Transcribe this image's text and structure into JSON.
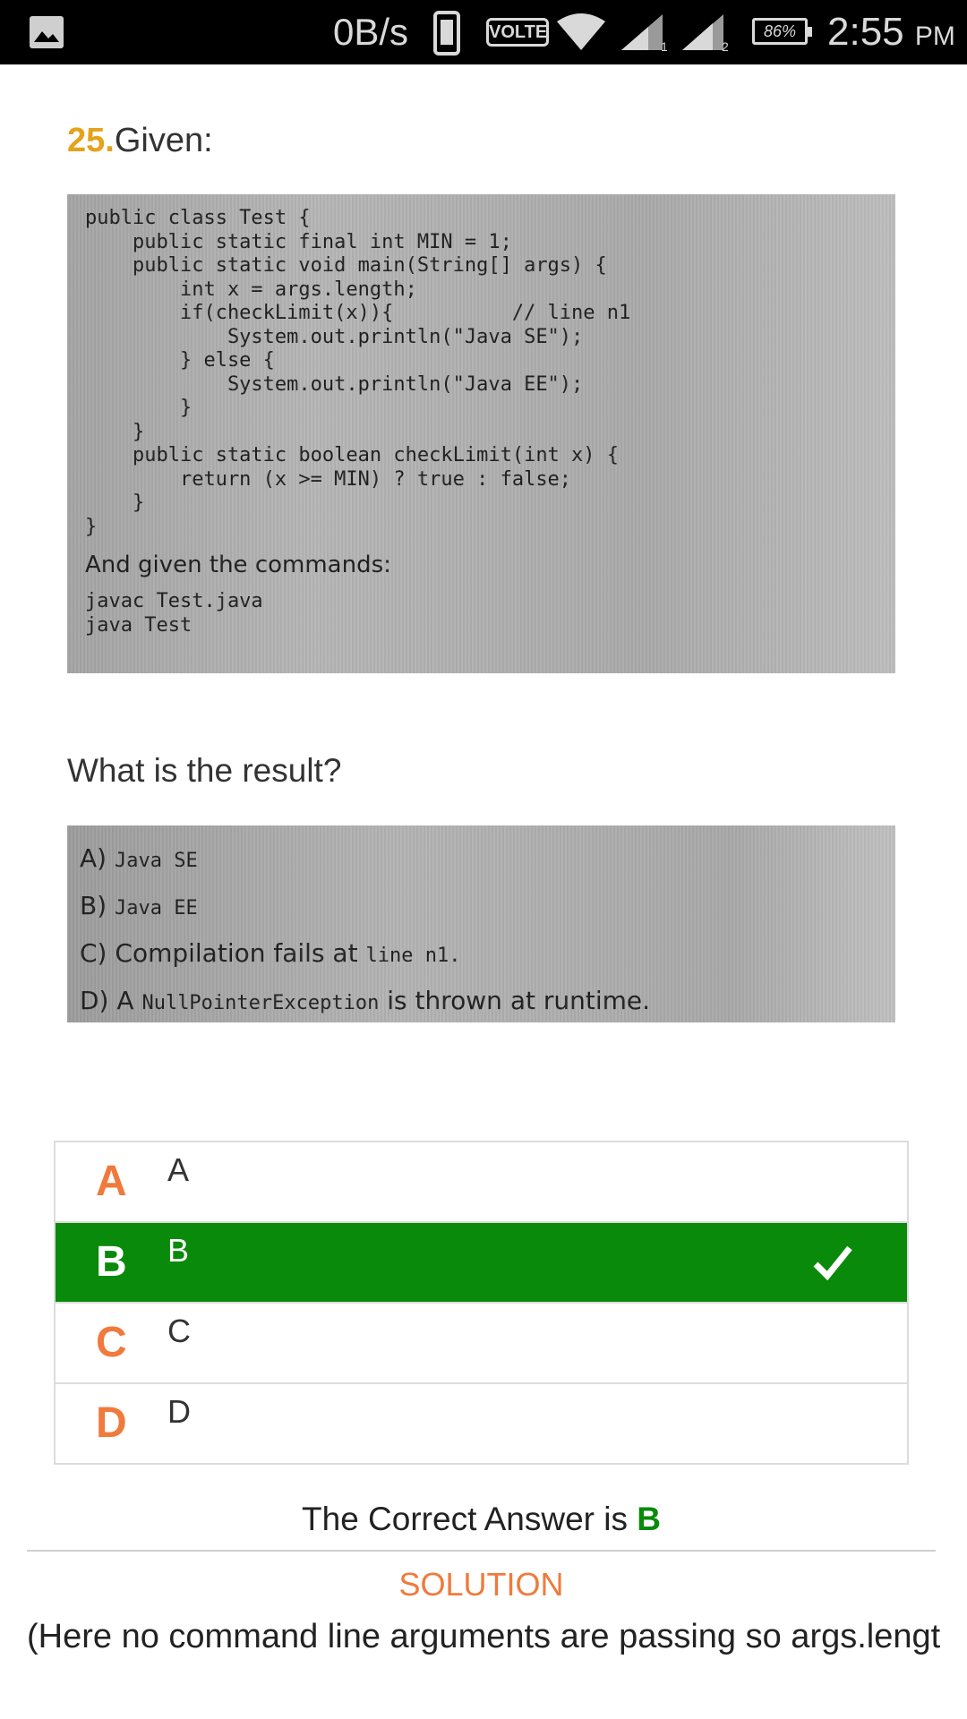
{
  "status_bar": {
    "speed": "0B/s",
    "volte": "VOLTE",
    "sim1": "1",
    "sim2": "2",
    "battery": "86%",
    "time": "2:55",
    "ampm": "PM"
  },
  "question": {
    "number": "25.",
    "title": "Given:",
    "code_lines": [
      "public class Test {",
      "    public static final int MIN = 1;",
      "    public static void main(String[] args) {",
      "        int x = args.length;",
      "        if(checkLimit(x)){          // line n1",
      "            System.out.println(\"Java SE\");",
      "        } else {",
      "            System.out.println(\"Java EE\");",
      "        }",
      "    }",
      "    public static boolean checkLimit(int x) {",
      "        return (x >= MIN) ? true : false;",
      "    }",
      "}"
    ],
    "commands_intro": "And given the commands:",
    "commands": [
      "javac Test.java",
      "java Test"
    ],
    "prompt": "What is the result?",
    "choices": [
      {
        "label": "A)",
        "plain": "",
        "code": "Java SE",
        "tail": ""
      },
      {
        "label": "B)",
        "plain": "",
        "code": "Java EE",
        "tail": ""
      },
      {
        "label": "C)",
        "plain": "Compilation fails at ",
        "code": "line n1.",
        "tail": ""
      },
      {
        "label": "D)",
        "plain": "A ",
        "code": "NullPointerException",
        "tail": " is thrown at runtime."
      }
    ]
  },
  "answers": [
    {
      "letter": "A",
      "text": "A",
      "selected": false
    },
    {
      "letter": "B",
      "text": "B",
      "selected": true
    },
    {
      "letter": "C",
      "text": "C",
      "selected": false
    },
    {
      "letter": "D",
      "text": "D",
      "selected": false
    }
  ],
  "result": {
    "prefix": "The Correct Answer is ",
    "answer": "B"
  },
  "solution": {
    "title": "SOLUTION",
    "text": "(Here no command line arguments are passing so args.lengt"
  },
  "colors": {
    "accent_orange": "#f07a3c",
    "question_number": "#e5a21b",
    "correct_green": "#0a8a0a"
  },
  "icons": {
    "status_image": "image-icon",
    "phone": "phone-icon",
    "wifi": "wifi-icon",
    "signal": "signal-icon",
    "check": "check-icon"
  }
}
